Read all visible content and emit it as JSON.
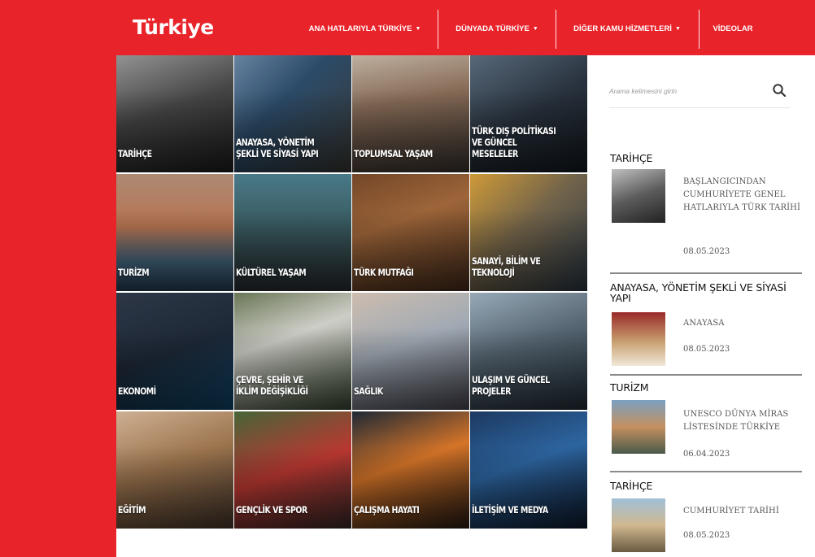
{
  "header": {
    "logo": "Türkiye",
    "nav": [
      {
        "label": "ANA HATLARIYLA TÜRKİYE",
        "dropdown": true
      },
      {
        "label": "DÜNYADA TÜRKİYE",
        "dropdown": true
      },
      {
        "label": "DİĞER KAMU HİZMETLERİ",
        "dropdown": true
      },
      {
        "label": "VİDEOLAR",
        "dropdown": false
      }
    ],
    "caret": "▼"
  },
  "colors": {
    "brand_red": "#e8232a"
  },
  "tiles": [
    {
      "label": "TARİHÇE"
    },
    {
      "label": "ANAYASA, YÖNETİM\nŞEKLİ VE SİYASİ YAPI"
    },
    {
      "label": "TOPLUMSAL YAŞAM"
    },
    {
      "label": "TÜRK DIŞ POLİTİKASI\nVE GÜNCEL\nMESELELER"
    },
    {
      "label": "TURİZM"
    },
    {
      "label": "KÜLTÜREL YAŞAM"
    },
    {
      "label": "TÜRK MUTFAĞI"
    },
    {
      "label": "SANAYİ, BİLİM VE\nTEKNOLOJİ"
    },
    {
      "label": "EKONOMİ"
    },
    {
      "label": "ÇEVRE, ŞEHİR VE\nİKLİM DEĞİŞİKLİĞİ"
    },
    {
      "label": "SAĞLIK"
    },
    {
      "label": "ULAŞIM VE GÜNCEL\nPROJELER"
    },
    {
      "label": "EĞİTİM"
    },
    {
      "label": "GENÇLİK VE SPOR"
    },
    {
      "label": "ÇALIŞMA HAYATI"
    },
    {
      "label": "İLETİŞİM VE MEDYA"
    }
  ],
  "search": {
    "placeholder": "Arama kelimesini girin",
    "icon": "search-icon"
  },
  "sidebar": [
    {
      "category": "TARİHÇE",
      "title": "BAŞLANGICINDAN CUMHURİYETE GENEL HATLARIYLA TÜRK TARİHİ",
      "date": "08.05.2023"
    },
    {
      "category": "ANAYASA, YÖNETİM ŞEKLİ VE SİYASİ YAPI",
      "title": "ANAYASA",
      "date": "08.05.2023"
    },
    {
      "category": "TURİZM",
      "title": "UNESCO DÜNYA MİRAS LİSTESİNDE TÜRKİYE",
      "date": "06.04.2023"
    },
    {
      "category": "TARİHÇE",
      "title": "CUMHURİYET TARİHİ",
      "date": "08.05.2023"
    }
  ]
}
